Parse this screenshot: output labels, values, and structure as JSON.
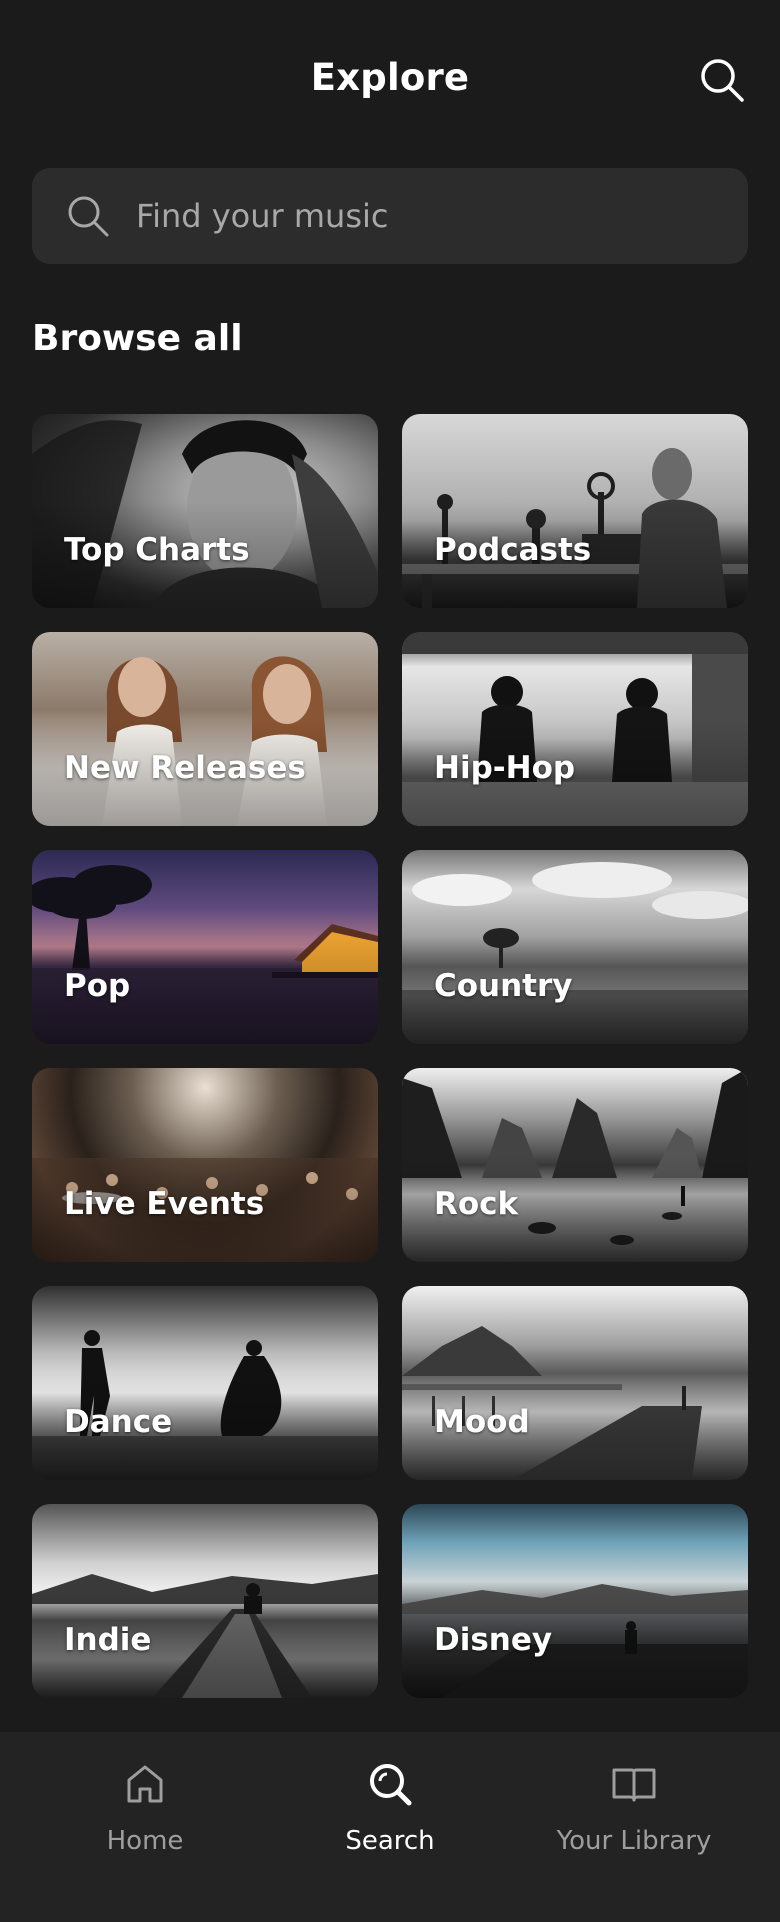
{
  "header": {
    "title": "Explore",
    "search_icon": "search-icon"
  },
  "search": {
    "placeholder": "Find your music",
    "icon": "search-icon"
  },
  "browse": {
    "heading": "Browse all",
    "categories": [
      {
        "label": "Top Charts"
      },
      {
        "label": "Podcasts"
      },
      {
        "label": "New Releases"
      },
      {
        "label": "Hip-Hop"
      },
      {
        "label": "Pop"
      },
      {
        "label": "Country"
      },
      {
        "label": "Live Events"
      },
      {
        "label": "Rock"
      },
      {
        "label": "Dance"
      },
      {
        "label": "Mood"
      },
      {
        "label": "Indie"
      },
      {
        "label": "Disney"
      }
    ]
  },
  "nav": {
    "items": [
      {
        "label": "Home",
        "icon": "home-icon",
        "active": false
      },
      {
        "label": "Search",
        "icon": "search-icon",
        "active": true
      },
      {
        "label": "Your Library",
        "icon": "library-book-icon",
        "active": false
      }
    ]
  },
  "colors": {
    "background": "#1b1b1b",
    "search_field": "#2c2c2c",
    "nav_background": "#232323",
    "inactive_text": "#9e9e9e",
    "active_text": "#ffffff"
  }
}
